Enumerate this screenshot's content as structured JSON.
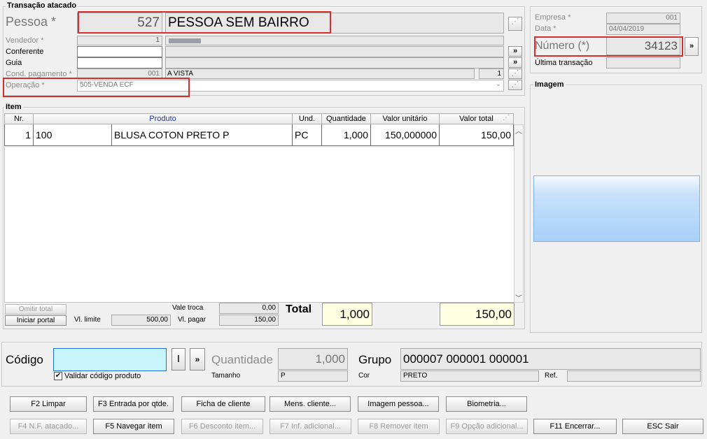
{
  "transacao": {
    "title": "Transação atacado",
    "pessoa_label": "Pessoa *",
    "pessoa_code": "527",
    "pessoa_name": "PESSOA SEM BAIRRO",
    "vendedor_label": "Vendedor *",
    "vendedor_code": "1",
    "conferente_label": "Conferente",
    "guia_label": "Guia",
    "cond_label": "Cond. pagamento *",
    "cond_code": "001",
    "cond_name": "A VISTA",
    "cond_parcelas": "1",
    "operacao_label": "Operação *",
    "operacao_value": "505-VENDA ECF",
    "more": "»",
    "dots": "⋰"
  },
  "empresa": {
    "empresa_label": "Empresa *",
    "empresa_value": "001",
    "data_label": "Data *",
    "data_value": "04/04/2019",
    "numero_label": "Número (*)",
    "numero_value": "34123",
    "ultima_label": "Última transação",
    "imagem_title": "Imagem"
  },
  "item": {
    "title": "Item",
    "columns": [
      "Nr.",
      "Produto",
      "Und.",
      "Quantidade",
      "Valor unitário",
      "Valor total"
    ],
    "rows": [
      {
        "nr": "1",
        "codigo": "100",
        "produto": "BLUSA COTON PRETO P",
        "und": "PC",
        "quantidade": "1,000",
        "valor_unitario": "150,000000",
        "valor_total": "150,00"
      }
    ]
  },
  "totais": {
    "omitir_total": "Omitir total",
    "iniciar_portal": "Iniciar portal",
    "vl_limite_label": "Vl. limite",
    "vl_limite_value": "500,00",
    "vale_troca_label": "Vale troca",
    "vale_troca_value": "0,00",
    "vl_pagar_label": "Vl. pagar",
    "vl_pagar_value": "150,00",
    "total_label": "Total",
    "total_qtd": "1,000",
    "total_valor": "150,00"
  },
  "entrada": {
    "codigo_label": "Código",
    "codigo_value": "",
    "i_btn": "I",
    "more": "»",
    "quantidade_label": "Quantidade",
    "quantidade_value": "1,000",
    "grupo_label": "Grupo",
    "grupo_value": "000007 000001 000001",
    "validar_label": "Validar código produto",
    "tamanho_label": "Tamanho",
    "tamanho_value": "P",
    "cor_label": "Cor",
    "cor_value": "PRETO",
    "ref_label": "Ref."
  },
  "buttons_row1": [
    "F2 Limpar",
    "F3 Entrada por qtde.",
    "Ficha de cliente",
    "Mens. cliente...",
    "Imagem pessoa...",
    "Biometria..."
  ],
  "buttons_row2": [
    "F4 N.F. atacado...",
    "F5 Navegar item",
    "F6 Desconto item...",
    "F7 Inf. adicional...",
    "F8 Remover item",
    "F9 Opção adicional...",
    "F11 Encerrar...",
    "ESC Sair"
  ],
  "colors": {
    "highlight_red": "#d32f2f",
    "input_cyan": "#c8f4fc",
    "total_yellow": "#ffffe1",
    "image_blue": "#a8d0f8"
  }
}
